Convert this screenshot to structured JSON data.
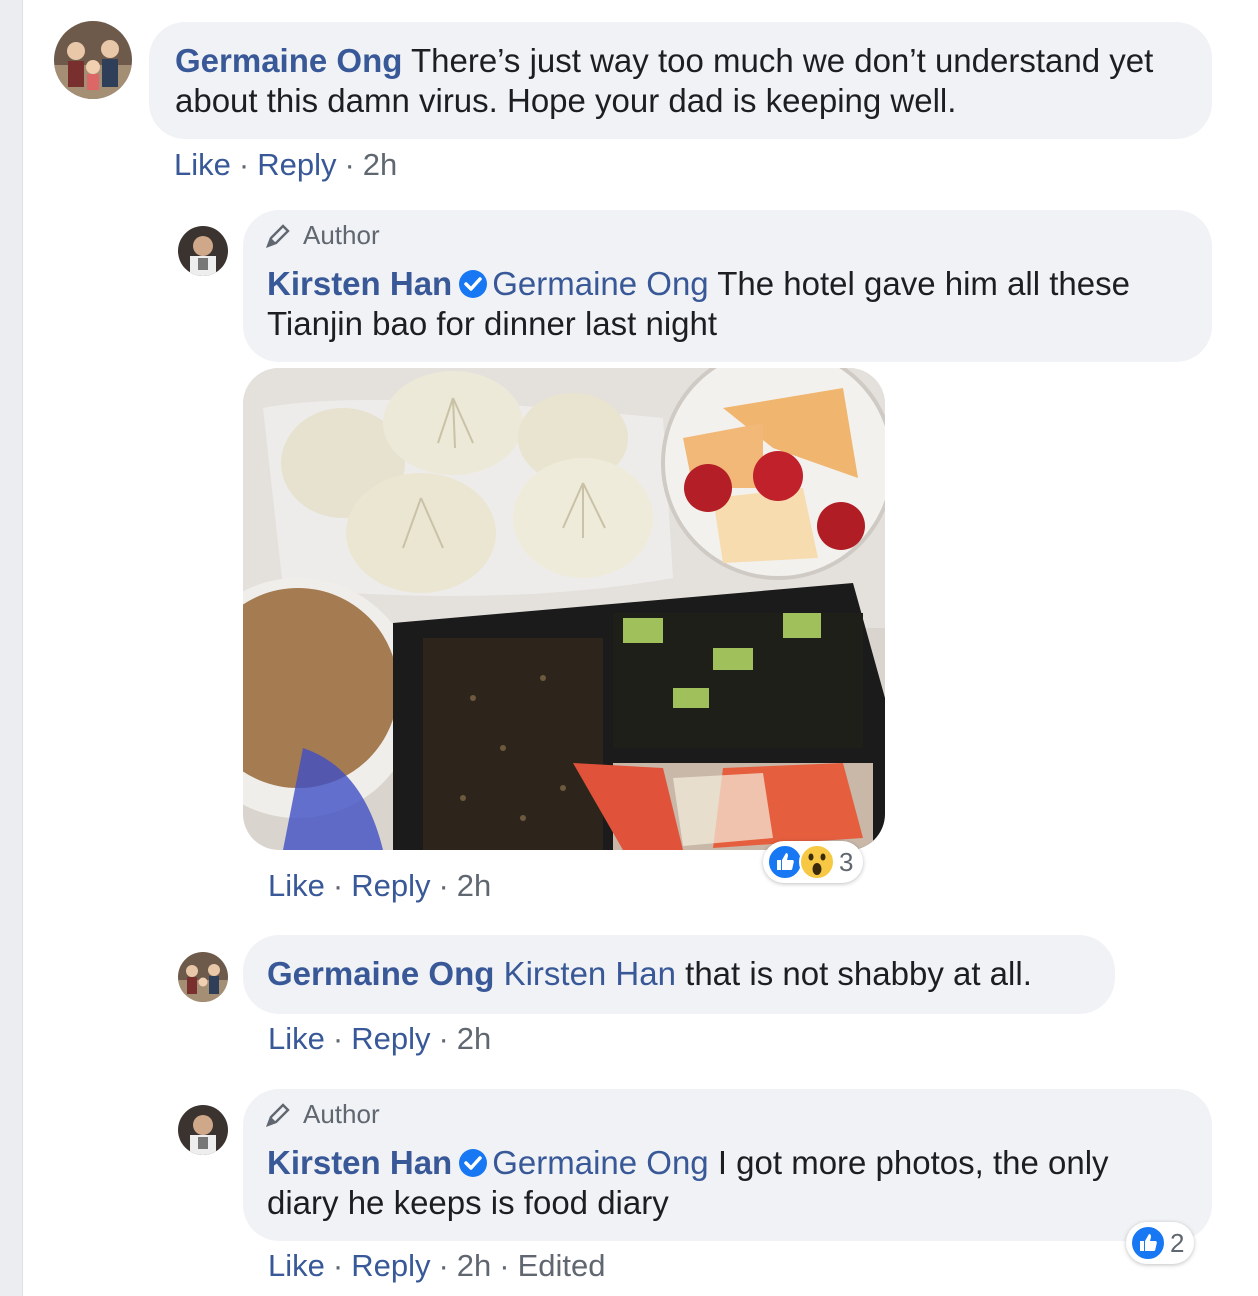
{
  "comments": [
    {
      "author": "Germaine Ong",
      "text": "There’s just way too much we don’t understand yet about this damn virus. Hope your dad is keeping well.",
      "actions": {
        "like": "Like",
        "reply": "Reply",
        "time": "2h"
      }
    },
    {
      "author_badge": "Author",
      "author": "Kirsten Han",
      "mention": "Germaine Ong",
      "text": "The hotel gave him all these Tianjin bao for dinner last night",
      "photo_alt": "Tianjin bao dinner photo",
      "reactions": {
        "count": "3",
        "icons": [
          "like-icon",
          "wow-icon"
        ]
      },
      "actions": {
        "like": "Like",
        "reply": "Reply",
        "time": "2h"
      }
    },
    {
      "author": "Germaine Ong",
      "mention": "Kirsten Han",
      "text": "that is not shabby at all.",
      "actions": {
        "like": "Like",
        "reply": "Reply",
        "time": "2h"
      }
    },
    {
      "author_badge": "Author",
      "author": "Kirsten Han",
      "mention": "Germaine Ong",
      "text": "I got more photos, the only diary he keeps is food diary",
      "reactions": {
        "count": "2",
        "icons": [
          "like-icon"
        ]
      },
      "actions": {
        "like": "Like",
        "reply": "Reply",
        "time": "2h",
        "edited": "Edited"
      }
    }
  ],
  "colors": {
    "link": "#385898",
    "bubble": "#f0f2f5",
    "meta": "#606770",
    "like_blue": "#1877f2"
  }
}
